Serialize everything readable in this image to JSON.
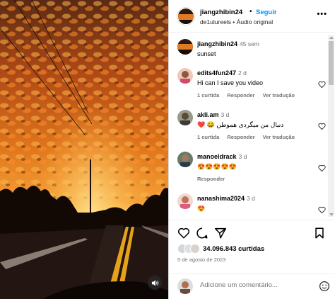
{
  "header": {
    "username": "jiangzhibin24",
    "dot": "•",
    "follow_label": "Seguir",
    "subtitle": "de1ulureels • Áudio original",
    "more": "•••"
  },
  "caption": {
    "username": "jiangzhibin24",
    "time": "45 sem",
    "text": "sunset"
  },
  "comments": [
    {
      "username": "edits4fun247",
      "time": "2 d",
      "text": "Hi can I save you video",
      "likes": "1 curtida",
      "reply": "Responder",
      "translate": "Ver tradução"
    },
    {
      "username": "akli.am",
      "time": "3 d",
      "text": "❤️ 😂 دنبال من میگردی هموطن",
      "likes": "1 curtida",
      "reply": "Responder",
      "translate": "Ver tradução"
    },
    {
      "username": "manoeldrack",
      "time": "3 d",
      "text": "😍😍😍😍😍",
      "likes": "",
      "reply": "Responder",
      "translate": ""
    },
    {
      "username": "nanashima2024",
      "time": "3 d",
      "text": "😍",
      "likes": "",
      "reply": "",
      "translate": ""
    }
  ],
  "likes_count": "34.096.843 curtidas",
  "date": "5 de agosto de 2023",
  "add_comment_placeholder": "Adicione um comentário...",
  "colors": {
    "accent": "#0095f6",
    "muted": "#737373"
  },
  "icons": [
    "heart-icon",
    "comment-icon",
    "share-icon",
    "bookmark-icon",
    "emoji-icon",
    "volume-icon",
    "more-icon"
  ]
}
